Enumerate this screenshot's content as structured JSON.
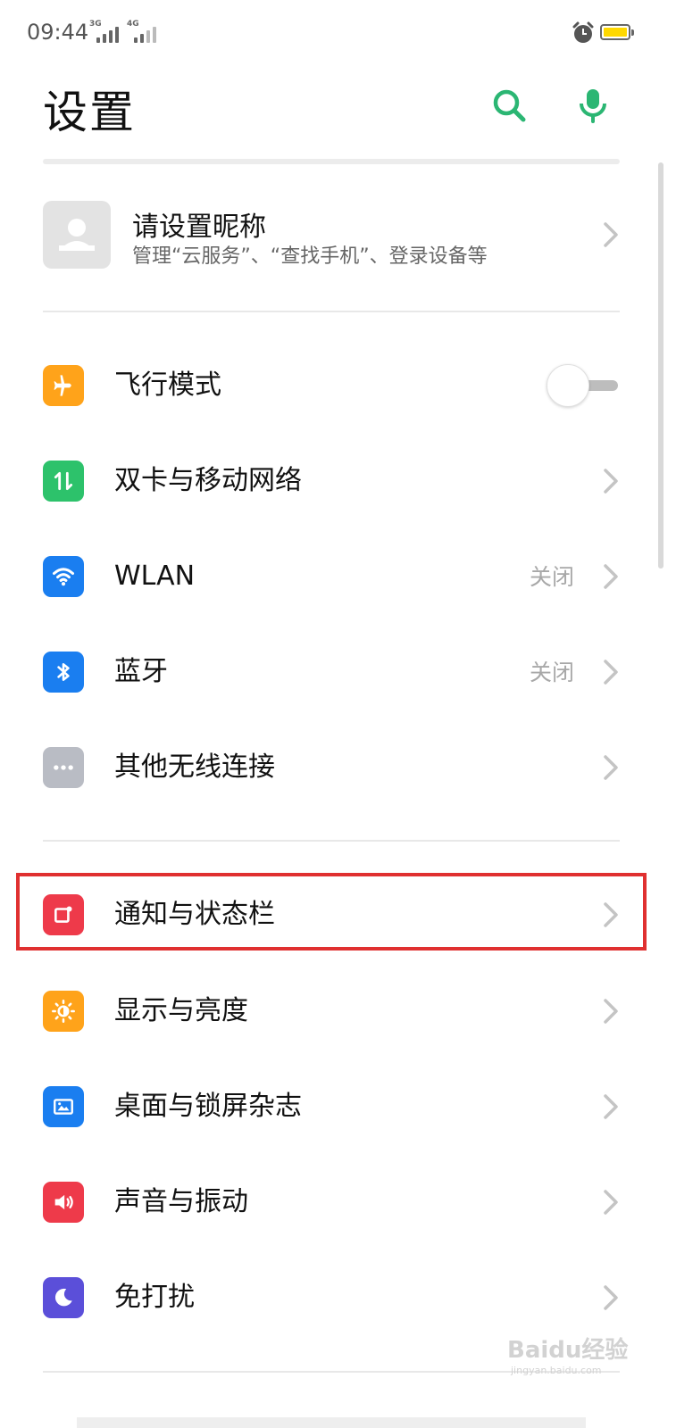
{
  "status_bar": {
    "time": "09:44",
    "network_1": "3G",
    "network_2": "4G",
    "battery_level": 0.9,
    "battery_color": "#ffd800"
  },
  "header": {
    "title": "设置",
    "search_icon": "search-icon",
    "voice_icon": "microphone-icon",
    "accent_color": "#2bb673"
  },
  "account": {
    "title": "请设置昵称",
    "subtitle": "管理“云服务”、“查找手机”、登录设备等"
  },
  "groups": {
    "connectivity": [
      {
        "label": "飞行模式",
        "icon": "airplane-icon",
        "color": "#ffa31a",
        "toggle": false
      },
      {
        "label": "双卡与移动网络",
        "icon": "dual-sim-icon",
        "color": "#2dc26b"
      },
      {
        "label": "WLAN",
        "icon": "wifi-icon",
        "color": "#1a7ef0",
        "value": "关闭"
      },
      {
        "label": "蓝牙",
        "icon": "bluetooth-icon",
        "color": "#1a7ef0",
        "value": "关闭"
      },
      {
        "label": "其他无线连接",
        "icon": "more-dots-icon",
        "color": "#b9bcc4"
      }
    ],
    "display": [
      {
        "label": "通知与状态栏",
        "icon": "notification-icon",
        "color": "#ee3a4a"
      },
      {
        "label": "显示与亮度",
        "icon": "brightness-icon",
        "color": "#ffa31a"
      },
      {
        "label": "桌面与锁屏杂志",
        "icon": "wallpaper-icon",
        "color": "#1a7ef0"
      },
      {
        "label": "声音与振动",
        "icon": "sound-icon",
        "color": "#ee3a4a"
      },
      {
        "label": "免打扰",
        "icon": "moon-icon",
        "color": "#5b4fd9"
      }
    ]
  },
  "watermark": {
    "text": "Baidu经验",
    "sub": "jingyan.baidu.com"
  }
}
